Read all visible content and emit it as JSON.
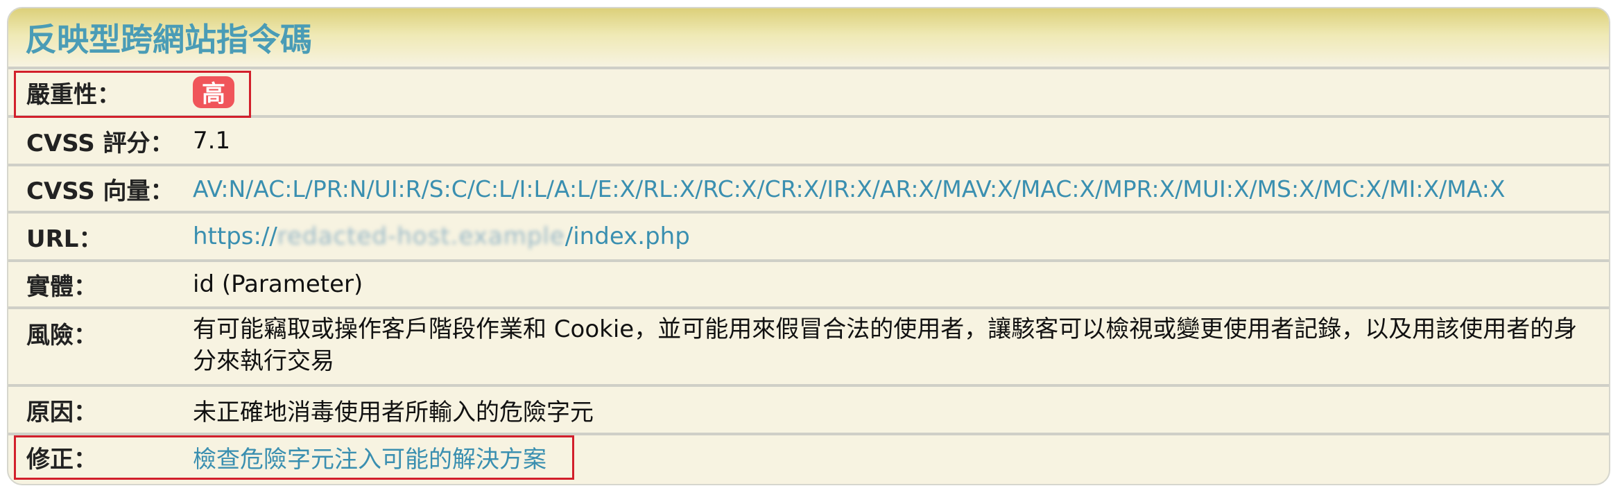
{
  "title": "反映型跨網站指令碼",
  "fields": {
    "severity": {
      "label": "嚴重性：",
      "value": "高"
    },
    "cvss_score": {
      "label": "CVSS 評分：",
      "value": "7.1"
    },
    "cvss_vector": {
      "label": "CVSS 向量：",
      "value": "AV:N/AC:L/PR:N/UI:R/S:C/C:L/I:L/A:L/E:X/RL:X/RC:X/CR:X/IR:X/AR:X/MAV:X/MAC:X/MPR:X/MUI:X/MS:X/MC:X/MI:X/MA:X"
    },
    "url": {
      "label": "URL：",
      "prefix": "https://",
      "redacted": "redacted-host.example",
      "suffix": "/index.php"
    },
    "entity": {
      "label": "實體：",
      "value": "id (Parameter)"
    },
    "risk": {
      "label": "風險：",
      "value": "有可能竊取或操作客戶階段作業和 Cookie，並可能用來假冒合法的使用者，讓駭客可以檢視或變更使用者記錄，以及用該使用者的身分來執行交易"
    },
    "cause": {
      "label": "原因：",
      "value": "未正確地消毒使用者所輸入的危險字元"
    },
    "fix": {
      "label": "修正：",
      "value": "檢查危險字元注入可能的解決方案"
    }
  },
  "colors": {
    "accent": "#4a9cb6",
    "link": "#3a8fb0",
    "badge": "#f0555a",
    "highlight": "#d21f2b",
    "panel_bg": "#f7f3e1"
  }
}
